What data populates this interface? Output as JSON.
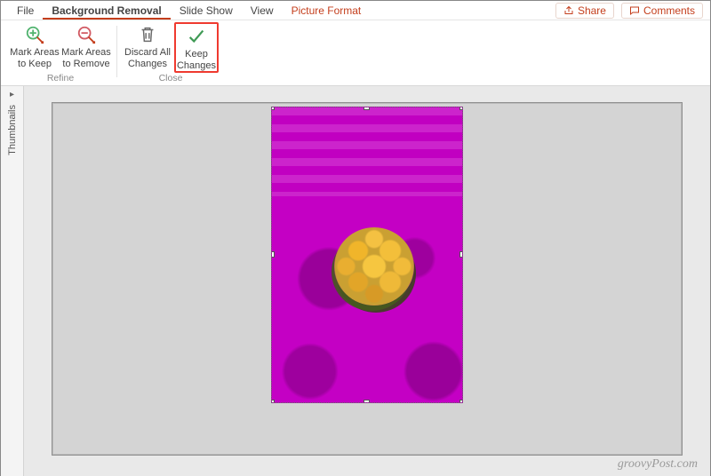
{
  "tabs": {
    "file": "File",
    "bg_removal": "Background Removal",
    "slide_show": "Slide Show",
    "view": "View",
    "picture_format": "Picture Format"
  },
  "topright": {
    "share": "Share",
    "comments": "Comments"
  },
  "ribbon": {
    "refine": {
      "group_label": "Refine",
      "mark_keep_l1": "Mark Areas",
      "mark_keep_l2": "to Keep",
      "mark_remove_l1": "Mark Areas",
      "mark_remove_l2": "to Remove"
    },
    "close": {
      "group_label": "Close",
      "discard_l1": "Discard All",
      "discard_l2": "Changes",
      "keep_l1": "Keep",
      "keep_l2": "Changes"
    }
  },
  "side_panel": {
    "thumbnails": "Thumbnails",
    "expand_glyph": "▸"
  },
  "watermark": "groovyPost.com"
}
